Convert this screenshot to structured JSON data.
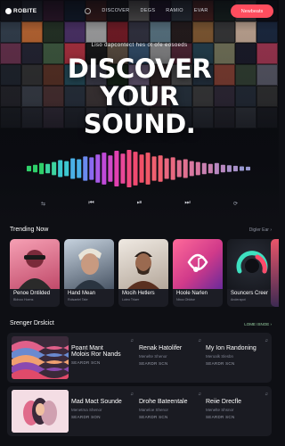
{
  "header": {
    "logo": "ROBITE",
    "nav": [
      "DISCOVER",
      "DEGS",
      "RAMIO",
      "EVAR"
    ],
    "cta_label": "Newbeats"
  },
  "hero": {
    "subtitle": "Liso dapcontect hes ot ofe eosoeds",
    "headline": [
      "DISCOVER",
      "YOUR",
      "SOUND."
    ],
    "controls": {
      "shuffle": "⇆",
      "prev": "⏮",
      "play": "⏯",
      "next": "⏭",
      "repeat": "⟳"
    },
    "mosaic_colors": [
      "#2b2f3a",
      "#4a5568",
      "#6b2f5a",
      "#1f3a5a",
      "#8a3b2e",
      "#2a2a2a",
      "#d9d4c7",
      "#3a1f4a",
      "#5a6b7a",
      "#b84a3a",
      "#2e4a3a",
      "#7a7a7a",
      "#1a1a24",
      "#3c4a5a",
      "#e07a3a",
      "#2a3a2a",
      "#5a3a7a",
      "#c2c2c2",
      "#8a1f2a",
      "#3a3a4a",
      "#6a8a9a",
      "#2a1f1f",
      "#9a6a3a",
      "#404040",
      "#e8c8b0",
      "#1f2f4a",
      "#7a3a5a",
      "#2a2a3a",
      "#4a6a4a",
      "#d03a4a",
      "#1a1a1a",
      "#6a5a4a",
      "#3a5a7a",
      "#a0a0a0",
      "#5a2a3a",
      "#2a4a5a",
      "#8a8a6a",
      "#1f1f2f",
      "#c04060",
      "#242a34",
      "#3a3a3a",
      "#6a3a2a",
      "#2a5a6a",
      "#4a4a5a",
      "#1a2a1a",
      "#7a6a8a",
      "#3a2a2a",
      "#5a5a5a",
      "#2a3a4a",
      "#9a4a3a",
      "#3a4a3a",
      "#6a6a7a",
      "#2a2a30",
      "#444a55",
      "#5a3a3a",
      "#303a48",
      "#4a4040",
      "#262b33",
      "#3b3f48",
      "#523a46",
      "#2f3d4a",
      "#454545",
      "#383040",
      "#2a3340",
      "#3a3a3a",
      "#1f2228",
      "#2c2f38",
      "#3a3240",
      "#262a33",
      "#34343c",
      "#22262e",
      "#2e3038",
      "#3a3434",
      "#242830",
      "#30343c",
      "#2a2a32",
      "#363a42",
      "#1e2026"
    ],
    "wave_levels": [
      0.15,
      0.2,
      0.3,
      0.25,
      0.35,
      0.45,
      0.4,
      0.55,
      0.5,
      0.65,
      0.6,
      0.75,
      0.85,
      0.7,
      0.95,
      0.8,
      1.0,
      0.9,
      0.75,
      0.85,
      0.65,
      0.7,
      0.55,
      0.6,
      0.45,
      0.5,
      0.4,
      0.35,
      0.3,
      0.25,
      0.3,
      0.2,
      0.18,
      0.15,
      0.12,
      0.1
    ],
    "wave_colors": [
      "#2fd06a",
      "#2fd06a",
      "#2fd06a",
      "#3dd4a0",
      "#3dd4a0",
      "#3dc8d0",
      "#3dc8d0",
      "#4ab0e8",
      "#4ab0e8",
      "#6a8af0",
      "#8a6af0",
      "#a85ae8",
      "#c04ad8",
      "#d04ac8",
      "#e040b0",
      "#e84898",
      "#f04a80",
      "#f04a70",
      "#f05068",
      "#f05868",
      "#f06070",
      "#f06070",
      "#e86880",
      "#e86880",
      "#e07090",
      "#e07090",
      "#d878a0",
      "#d878a0",
      "#c880b0",
      "#c880b0",
      "#b888c0",
      "#b888c0",
      "#a890c8",
      "#a890c8",
      "#9898d0",
      "#9898d0"
    ]
  },
  "trending": {
    "heading": "Trending Now",
    "link": "Digler Ear ›",
    "cards": [
      {
        "title": "Penoe Dntilded",
        "artist": "Bldvoo Hoens",
        "bg": [
          "#f08aa0",
          "#a83a5a"
        ]
      },
      {
        "title": "Hand Mean",
        "artist": "Rolsaelel Tabr",
        "bg": [
          "#b8c8d8",
          "#4a5a6a"
        ]
      },
      {
        "title": "Mocih Hetlers",
        "artist": "Loteo Trlaer",
        "bg": [
          "#e8e0d8",
          "#8a7060"
        ]
      },
      {
        "title": "Hoole Narlen",
        "artist": "Nboo Ohldse",
        "bg": [
          "#ff5a8a",
          "#7a2a8a"
        ]
      },
      {
        "title": "Souncers Creer",
        "artist": "Anderapot",
        "bg": [
          "#3a3f4a",
          "#1c1f26"
        ]
      }
    ]
  },
  "playlist": {
    "heading": "Srenger Drslcict",
    "link": "LOME ISNOE ›",
    "rows": [
      {
        "tracks": [
          {
            "name": "Poant Mant",
            "name2": "Molois Ror Nands",
            "meta": "SEARDR SCN"
          },
          {
            "name": "Renak Hatolifer",
            "artist": "Menelte Shenor",
            "meta": "SEARDR SCN"
          },
          {
            "name": "My Ion Randoning",
            "artist": "Meroalk Slesbn",
            "meta": "SEARDR SCN"
          }
        ]
      },
      {
        "tracks": [
          {
            "name": "Mad Mact Sounde",
            "artist": "Menetma Shenor",
            "meta": "SEARDR SON"
          },
          {
            "name": "Drohe Bateentale",
            "artist": "Maneloe Shenor",
            "meta": "SEARDR SCN"
          },
          {
            "name": "Reiie Drecfle",
            "artist": "Menelte Shsnor",
            "meta": "SEARDR SCN"
          }
        ]
      }
    ]
  }
}
